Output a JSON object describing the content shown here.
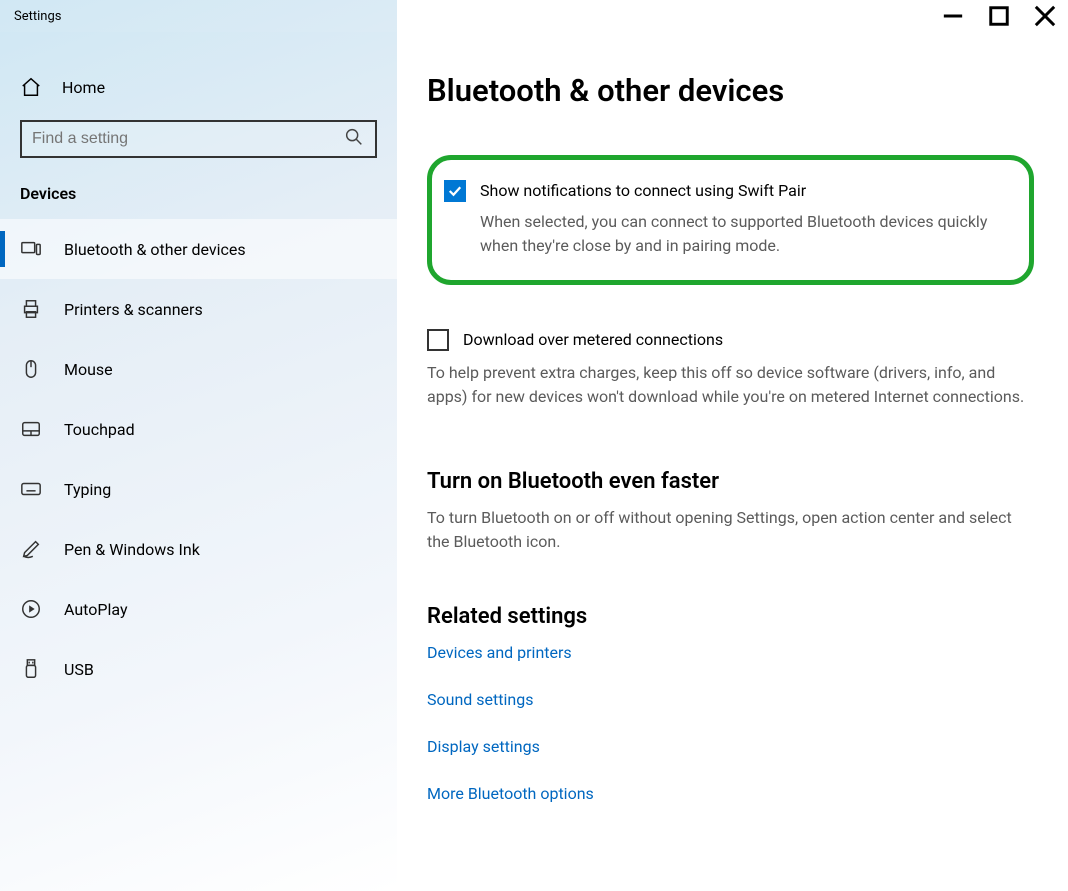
{
  "window": {
    "title": "Settings"
  },
  "sidebar": {
    "home": "Home",
    "search_placeholder": "Find a setting",
    "category": "Devices",
    "items": [
      {
        "label": "Bluetooth & other devices"
      },
      {
        "label": "Printers & scanners"
      },
      {
        "label": "Mouse"
      },
      {
        "label": "Touchpad"
      },
      {
        "label": "Typing"
      },
      {
        "label": "Pen & Windows Ink"
      },
      {
        "label": "AutoPlay"
      },
      {
        "label": "USB"
      }
    ]
  },
  "page": {
    "title": "Bluetooth & other devices",
    "swift_pair": {
      "label": "Show notifications to connect using Swift Pair",
      "description": "When selected, you can connect to supported Bluetooth devices quickly when they're close by and in pairing mode."
    },
    "metered": {
      "label": "Download over metered connections",
      "description": "To help prevent extra charges, keep this off so device software (drivers, info, and apps) for new devices won't download while you're on metered Internet connections."
    },
    "faster": {
      "heading": "Turn on Bluetooth even faster",
      "description": "To turn Bluetooth on or off without opening Settings, open action center and select the Bluetooth icon."
    },
    "related": {
      "heading": "Related settings",
      "links": [
        "Devices and printers",
        "Sound settings",
        "Display settings",
        "More Bluetooth options"
      ]
    }
  }
}
